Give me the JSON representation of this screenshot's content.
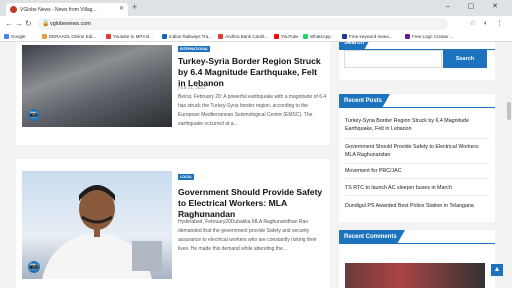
{
  "browser": {
    "tab_title": "VGlobe News - News from Villag...",
    "url": "vglobenews.com",
    "new_tab": "+",
    "window_controls": "– ▢ ✕",
    "bookmarks": [
      {
        "label": "Google",
        "color": "#4285f4"
      },
      {
        "label": "DERAADL Online Edi...",
        "color": "#e2a23b"
      },
      {
        "label": "Youtube to MP4 B...",
        "color": "#e53935"
      },
      {
        "label": "Indian Railways Tra...",
        "color": "#1565c0"
      },
      {
        "label": "Andhra Bank Cardit...",
        "color": "#e53935"
      },
      {
        "label": "YouTube",
        "color": "#ff0000"
      },
      {
        "label": "WhatsApp",
        "color": "#25d366"
      },
      {
        "label": "Free keyword resea...",
        "color": "#1e3a8a"
      },
      {
        "label": "Free Logo Creator ...",
        "color": "#6a1b9a"
      }
    ]
  },
  "posts": [
    {
      "category": "INTERNATIONAL",
      "title": "Turkey-Syria Border Region Struck by 6.4 Magnitude Earthquake, Felt in Lebanon",
      "date": "FEB 21, 2023",
      "excerpt": "Beirut, February 20: A powerful earthquake with a magnitude of 6.4 has struck the Turkey-Syria border region, according to the European Mediterranean Seismological Centre (EMSC). The earthquake occurred at a..."
    },
    {
      "category": "LOCAL",
      "title": "Government Should Provide Safety to Electrical Workers: MLA Raghunandan",
      "date": "FEB 20, 2023",
      "excerpt": "Hyderabad, February20Dubakka MLA Raghunandhan Rao demanded that the government provide Safety and security assurance to electrical workers who are constantly risking their lives. He made this demand while attending the..."
    }
  ],
  "sidebar": {
    "search": {
      "title": "Search",
      "button": "Search",
      "placeholder": ""
    },
    "recent_posts": {
      "title": "Recent Posts",
      "items": [
        "Turkey-Syria Border Region Struck by 6.4 Magnitude Earthquake, Felt in Lebanon",
        "Government Should Provide Safety to Electrical Workers: MLA Raghunandan",
        "Movement for PRC/JAC",
        "TS RTC to launch AC sleeper buses in March",
        "Dundigul PS Awarded Best Police Station in Telangana"
      ]
    },
    "recent_comments": {
      "title": "Recent Comments"
    }
  },
  "icons": {
    "camera": "📷",
    "back_to_top": "▲"
  },
  "colors": {
    "accent": "#1e73be"
  }
}
